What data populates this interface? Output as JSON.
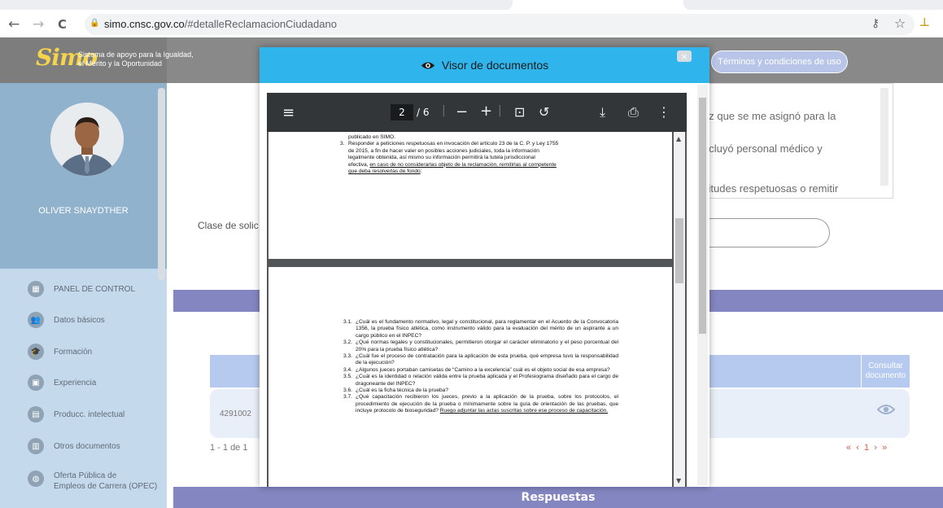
{
  "browser": {
    "url_host": "simo.cnsc.gov.co",
    "url_path": "/#detalleReclamacionCiudadano",
    "back_glyph": "←",
    "forward_glyph": "→",
    "reload_glyph": "C",
    "lock_glyph": "🔒",
    "key_glyph": "⚷",
    "star_glyph": "☆",
    "ext_glyph": "⊥"
  },
  "header": {
    "logo_mark": "Simo",
    "logo_line1": "Sistema de apoyo para la Igualdad,",
    "logo_line2": "el Mérito y la Oportunidad",
    "terms_label": "Términos y condiciones de uso"
  },
  "sidebar": {
    "user_name": "OLIVER SNAYDTHER",
    "items": [
      {
        "label": "PANEL DE CONTROL",
        "icon": "grid-icon"
      },
      {
        "label": "Datos básicos",
        "icon": "people-icon"
      },
      {
        "label": "Formación",
        "icon": "graduation-icon"
      },
      {
        "label": "Experiencia",
        "icon": "briefcase-icon"
      },
      {
        "label": "Producc. intelectual",
        "icon": "book-icon"
      },
      {
        "label": "Otros documentos",
        "icon": "document-icon"
      },
      {
        "label": "Oferta Pública de",
        "label2": "Empleos de Carrera (OPEC)",
        "icon": "globe-icon"
      }
    ]
  },
  "main": {
    "textarea_lines": [
      "ez que se me asignó para la",
      "ncluyó personal médico y",
      "citudes respetuosas o remitir"
    ],
    "clase_label": "Clase de solic",
    "consultar_header_1": "Consultar",
    "consultar_header_2": "documento",
    "row_id": "4291002",
    "paging": "1 - 1 de 1",
    "pager_first": "«",
    "pager_prev": "‹",
    "pager_page": "1",
    "pager_next": "›",
    "pager_last": "»",
    "footer_title": "Respuestas"
  },
  "modal": {
    "title": "Visor de documentos",
    "close_label": "×"
  },
  "pdf": {
    "current_page": "2",
    "total_label": "/ 6",
    "page1": {
      "l0": "publicado en SIMO.",
      "l1": "Responder a peticiones respetuosas en invocación del artículo 23 de la C. P. y Ley 1755",
      "l2": "de 2015, a fin de hacer valer en posibles acciones judiciales, toda la información",
      "l3": "legalmente obtenida, así mismo su información permitirá la tutela jurisdiccional",
      "l4a": "efectiva, ",
      "l4b": "en caso de no considerarlas objeto de la reclamación, remitirlas al competente",
      "l5": "que deba resolverlas de fondo",
      "l5b": ":",
      "num": "3."
    },
    "page2": [
      {
        "n": "3.1.",
        "t": "¿Cuál es el fundamento normativo, legal y constitucional, para reglamentar en el Acuerdo de la Convocatoria 1356, la prueba físico atlética, como instrumento válido para la evaluación del mérito de un aspirante a un cargo público en el INPEC?"
      },
      {
        "n": "3.2.",
        "t": "¿Qué normas legales y constitucionales, permitieron otorgar el carácter eliminatorio y el peso porcentual del 20% para la prueba físico atlética?"
      },
      {
        "n": "3.3.",
        "t": "¿Cuál fue el proceso de contratación para la aplicación de esta prueba, qué empresa tuvo la responsabilidad de la ejecución?"
      },
      {
        "n": "3.4.",
        "t": "¿Algunos jueces portaban camisetas de “Camino a la excelencia” cuál es el objeto social de esa empresa?"
      },
      {
        "n": "3.5.",
        "t": "¿Cuál es la identidad o relación válida entre la prueba aplicada y el Profesiograma diseñado para el cargo de dragoneante del INPEC?"
      },
      {
        "n": "3.6.",
        "t": "¿Cuál es la ficha técnica de la prueba?"
      },
      {
        "n": "3.7.",
        "t": "¿Qué capacitación recibieron los jueces, previo a la aplicación de la prueba, sobre los protocolos, el procedimiento de ejecución de la prueba o mínimamente sobre la guía de orientación de las pruebas, que incluye protocolo de bioseguridad?",
        "u": "Ruego adjuntar las actas suscritas sobre ese proceso de capacitación."
      }
    ]
  }
}
